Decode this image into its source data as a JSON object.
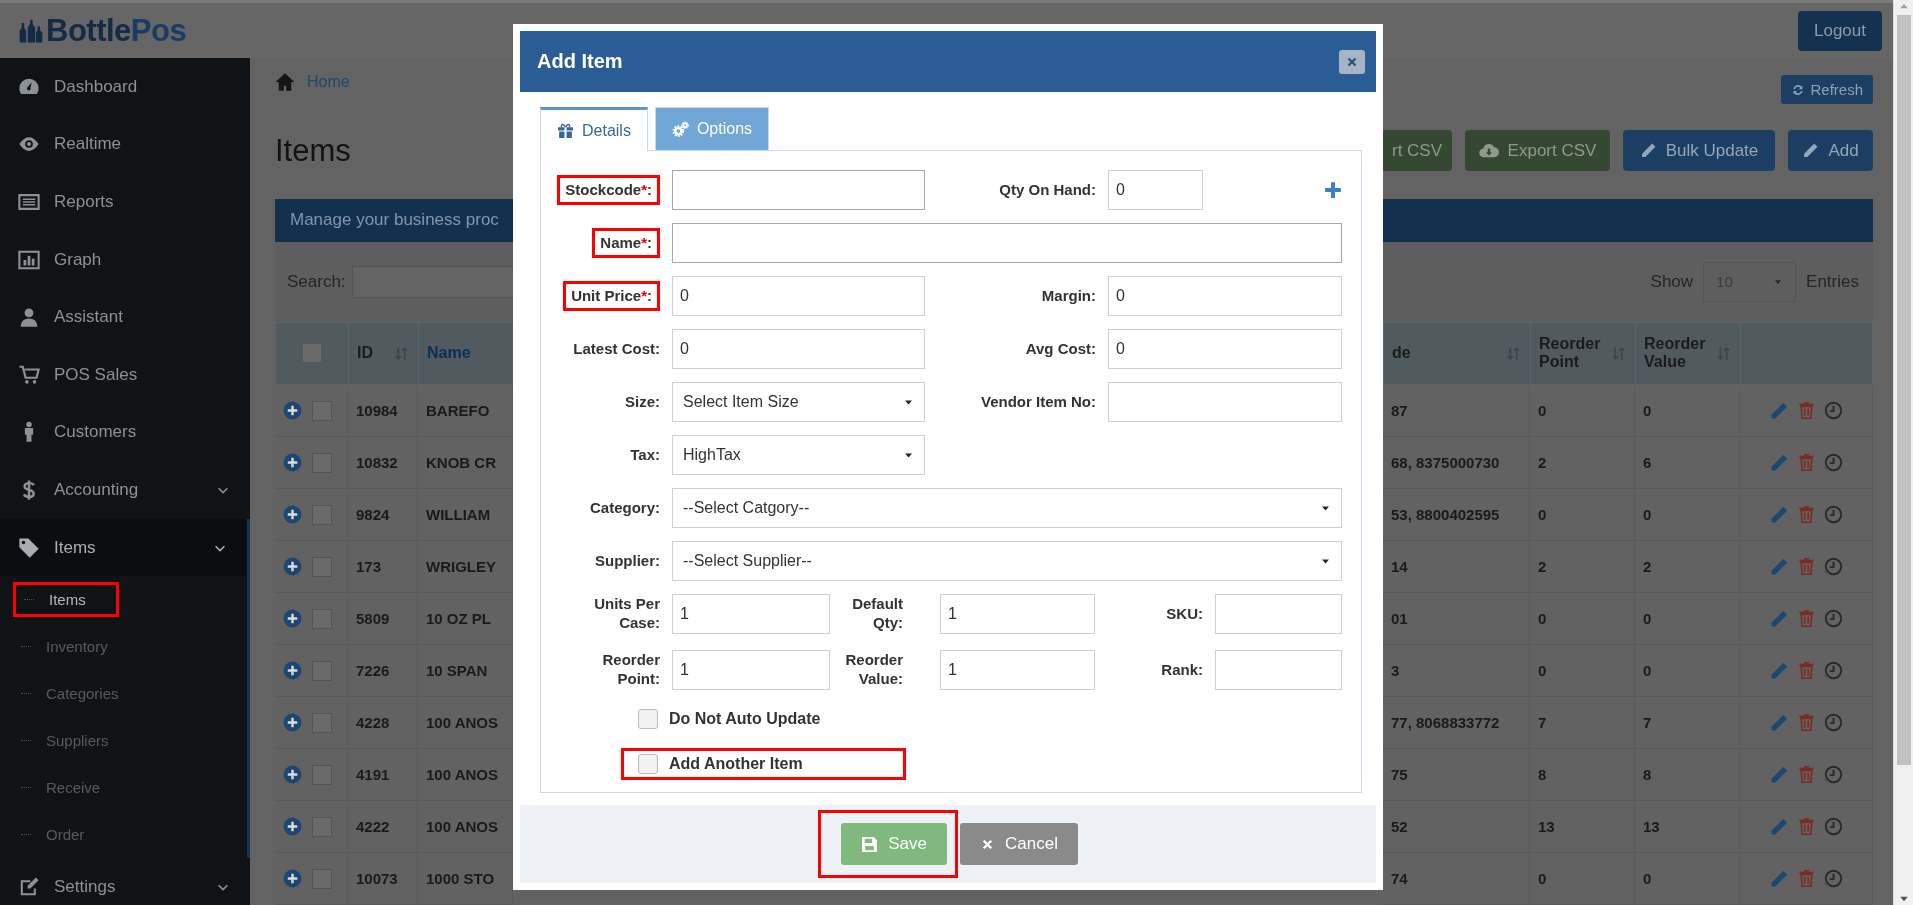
{
  "header": {
    "logo_primary": "Bottle",
    "logo_secondary": "Pos",
    "logout": "Logout"
  },
  "sidebar": {
    "items": [
      {
        "label": "Dashboard",
        "has_submenu": false,
        "expanded": false
      },
      {
        "label": "Realtime",
        "has_submenu": false,
        "expanded": false
      },
      {
        "label": "Reports",
        "has_submenu": false,
        "expanded": false
      },
      {
        "label": "Graph",
        "has_submenu": false,
        "expanded": false
      },
      {
        "label": "Assistant",
        "has_submenu": false,
        "expanded": false
      },
      {
        "label": "POS Sales",
        "has_submenu": false,
        "expanded": false
      },
      {
        "label": "Customers",
        "has_submenu": false,
        "expanded": false
      },
      {
        "label": "Accounting",
        "has_submenu": true,
        "expanded": false
      },
      {
        "label": "Items",
        "has_submenu": true,
        "expanded": true,
        "children": [
          {
            "label": "Items",
            "selected": true,
            "highlighted": true
          },
          {
            "label": "Inventory",
            "selected": false,
            "highlighted": false
          },
          {
            "label": "Categories",
            "selected": false,
            "highlighted": false
          },
          {
            "label": "Suppliers",
            "selected": false,
            "highlighted": false
          },
          {
            "label": "Receive",
            "selected": false,
            "highlighted": false
          },
          {
            "label": "Order",
            "selected": false,
            "highlighted": false
          }
        ]
      },
      {
        "label": "Settings",
        "has_submenu": true,
        "expanded": false
      }
    ]
  },
  "breadcrumb": {
    "home": "Home",
    "refresh": "Refresh"
  },
  "page_title": "Items",
  "toolbar": [
    {
      "label": "rt CSV",
      "kind": "import"
    },
    {
      "label": "Export CSV",
      "kind": "export"
    },
    {
      "label": "Bulk Update",
      "kind": "edit"
    },
    {
      "label": "Add",
      "kind": "edit"
    }
  ],
  "banner": "Manage your business proc",
  "search": {
    "label": "Search:",
    "show": "Show",
    "page_size": "10",
    "entries": "Entries"
  },
  "table": {
    "all_checked": false,
    "columns": [
      {
        "label": "ID",
        "sort_icon": true,
        "active": false
      },
      {
        "label": "Name",
        "sort_icon": false,
        "active": true
      },
      {
        "label": "de",
        "sort_icon": true,
        "active": false
      },
      {
        "label": "Reorder Point",
        "sort_icon": true,
        "active": false
      },
      {
        "label": "Reorder Value",
        "sort_icon": true,
        "active": false
      }
    ],
    "rows": [
      {
        "id": "10984",
        "name": "BAREFO",
        "barcode": "87",
        "reorder_point": "0",
        "reorder_value": "0",
        "checked": false
      },
      {
        "id": "10832",
        "name": "KNOB CR",
        "barcode": "68, 8375000730",
        "reorder_point": "2",
        "reorder_value": "6",
        "checked": false
      },
      {
        "id": "9824",
        "name": "WILLIAM",
        "barcode": "53, 8800402595",
        "reorder_point": "0",
        "reorder_value": "0",
        "checked": false
      },
      {
        "id": "173",
        "name": "WRIGLEY",
        "barcode": "14",
        "reorder_point": "2",
        "reorder_value": "2",
        "checked": false
      },
      {
        "id": "5809",
        "name": "10 OZ PL",
        "barcode": "01",
        "reorder_point": "0",
        "reorder_value": "0",
        "checked": false
      },
      {
        "id": "7226",
        "name": "10 SPAN",
        "barcode": "3",
        "reorder_point": "0",
        "reorder_value": "0",
        "checked": false
      },
      {
        "id": "4228",
        "name": "100 ANOS",
        "barcode": "77, 8068833772",
        "reorder_point": "7",
        "reorder_value": "7",
        "checked": false
      },
      {
        "id": "4191",
        "name": "100 ANOS",
        "barcode": "75",
        "reorder_point": "8",
        "reorder_value": "8",
        "checked": false
      },
      {
        "id": "4222",
        "name": "100 ANOS",
        "barcode": "52",
        "reorder_point": "13",
        "reorder_value": "13",
        "checked": false
      },
      {
        "id": "10073",
        "name": "1000 STO",
        "barcode": "74",
        "reorder_point": "0",
        "reorder_value": "0",
        "checked": false
      }
    ]
  },
  "modal": {
    "title": "Add Item",
    "tabs": [
      {
        "label": "Details",
        "selected": true
      },
      {
        "label": "Options",
        "selected": false
      }
    ],
    "rows": [
      {
        "kind": "pair",
        "add_button": true,
        "fields": [
          {
            "label": "Stockcode",
            "mark": "*",
            "suffix": ":",
            "highlighted": true,
            "kind": "text"
          },
          {
            "label": "Qty On Hand:",
            "highlighted": false,
            "kind": "text",
            "value": "0"
          }
        ]
      },
      {
        "kind": "wide",
        "fields": [
          {
            "label": "Name",
            "mark": "*",
            "suffix": ":",
            "highlighted": true,
            "kind": "text"
          }
        ]
      },
      {
        "kind": "pair",
        "add_button": false,
        "fields": [
          {
            "label": "Unit Price",
            "mark": "*",
            "suffix": ":",
            "highlighted": true,
            "kind": "text",
            "value": "0"
          },
          {
            "label": "Margin:",
            "highlighted": false,
            "kind": "text",
            "value": "0"
          }
        ]
      },
      {
        "kind": "pair",
        "add_button": false,
        "fields": [
          {
            "label": "Latest Cost:",
            "highlighted": false,
            "kind": "text",
            "value": "0"
          },
          {
            "label": "Avg Cost:",
            "highlighted": false,
            "kind": "text",
            "value": "0"
          }
        ]
      },
      {
        "kind": "pair",
        "add_button": false,
        "fields": [
          {
            "label": "Size:",
            "highlighted": false,
            "kind": "select",
            "value": "Select Item Size"
          },
          {
            "label": "Vendor Item No:",
            "highlighted": false,
            "kind": "text"
          }
        ]
      },
      {
        "kind": "single",
        "fields": [
          {
            "label": "Tax:",
            "highlighted": false,
            "kind": "select",
            "value": "HighTax"
          }
        ]
      },
      {
        "kind": "wide",
        "fields": [
          {
            "label": "Category:",
            "highlighted": false,
            "kind": "select",
            "value": "--Select Catgory--"
          }
        ]
      },
      {
        "kind": "wide",
        "fields": [
          {
            "label": "Supplier:",
            "highlighted": false,
            "kind": "select",
            "value": "--Select Supplier--"
          }
        ]
      },
      {
        "kind": "triple",
        "fields": [
          {
            "label": "Units Per Case:",
            "highlighted": false,
            "kind": "text",
            "value": "1"
          },
          {
            "label": "Default Qty:",
            "highlighted": false,
            "kind": "text",
            "value": "1"
          },
          {
            "label": "SKU:",
            "highlighted": false,
            "kind": "text"
          }
        ]
      },
      {
        "kind": "triple",
        "fields": [
          {
            "label": "Reorder Point:",
            "highlighted": false,
            "kind": "text",
            "value": "1"
          },
          {
            "label": "Reorder Value:",
            "highlighted": false,
            "kind": "text",
            "value": "1"
          },
          {
            "label": "Rank:",
            "highlighted": false,
            "kind": "text"
          }
        ]
      }
    ],
    "checkboxes": [
      {
        "label": "Do Not Auto Update",
        "checked": false,
        "highlighted": false
      },
      {
        "label": "Add Another Item",
        "checked": false,
        "highlighted": true
      }
    ],
    "buttons": [
      {
        "label": "Save",
        "kind": "primary",
        "highlighted": true
      },
      {
        "label": "Cancel",
        "kind": "secondary",
        "highlighted": false
      }
    ]
  }
}
